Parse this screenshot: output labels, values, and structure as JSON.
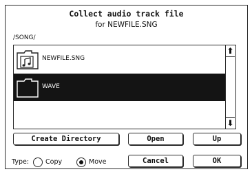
{
  "dialog": {
    "title": "Collect audio track file",
    "subtitle": "for NEWFILE.SNG",
    "path": "/SONG/"
  },
  "file_list": {
    "items": [
      {
        "name": "NEWFILE.SNG",
        "icon": "song-file-icon",
        "selected": false
      },
      {
        "name": "WAVE",
        "icon": "folder-icon",
        "selected": true
      }
    ]
  },
  "scrollbar": {
    "up_glyph": "⬆",
    "down_glyph": "⬇"
  },
  "buttons": {
    "create_directory": "Create Directory",
    "open": "Open",
    "up": "Up",
    "cancel": "Cancel",
    "ok": "OK"
  },
  "type": {
    "label": "Type:",
    "options": [
      "Copy",
      "Move"
    ],
    "selected": "Move"
  }
}
